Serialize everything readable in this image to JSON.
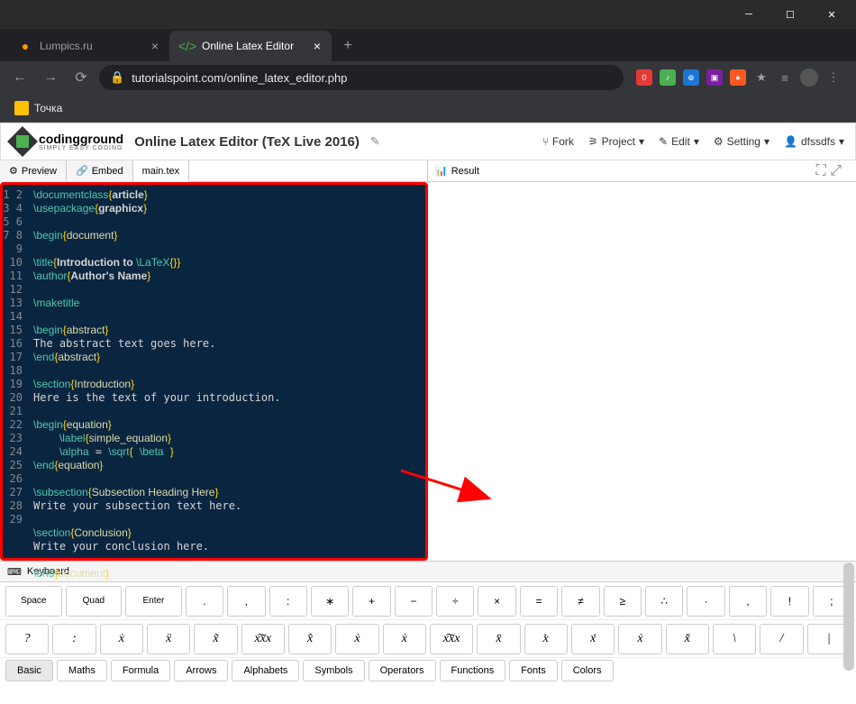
{
  "tabs": [
    {
      "label": "Lumpics.ru",
      "icon_color": "#ff9800"
    },
    {
      "label": "Online Latex Editor",
      "icon_color": "#4caf50"
    }
  ],
  "url": "tutorialspoint.com/online_latex_editor.php",
  "bookmark": "Точка",
  "logo": {
    "main": "codingground",
    "sub": "SIMPLY EASY CODING"
  },
  "page_title": "Online Latex Editor (TeX Live 2016)",
  "header_actions": {
    "fork": "Fork",
    "project": "Project",
    "edit": "Edit",
    "setting": "Setting",
    "user": "dfssdfs"
  },
  "panel_tabs": {
    "preview": "Preview",
    "embed": "Embed",
    "file": "main.tex",
    "result": "Result"
  },
  "code_lines": [
    {
      "n": 1,
      "html": "<span class='kw'>\\documentclass</span><span class='br'>{</span><span class='arg'>article</span><span class='br'>}</span>"
    },
    {
      "n": 2,
      "html": "<span class='kw'>\\usepackage</span><span class='br'>{</span><span class='arg'>graphicx</span><span class='br'>}</span>"
    },
    {
      "n": 3,
      "html": ""
    },
    {
      "n": 4,
      "html": "<span class='kw'>\\begin</span><span class='br'>{</span><span class='cur'>document</span><span class='br'>}</span>"
    },
    {
      "n": 5,
      "html": ""
    },
    {
      "n": 6,
      "html": "<span class='kw'>\\title</span><span class='br'>{</span><span class='arg'>Introduction to </span><span class='kw'>\\LaTeX</span><span class='br'>{}}</span>"
    },
    {
      "n": 7,
      "html": "<span class='kw'>\\author</span><span class='br'>{</span><span class='arg'>Author's Name</span><span class='br'>}</span>"
    },
    {
      "n": 8,
      "html": ""
    },
    {
      "n": 9,
      "html": "<span class='kw'>\\maketitle</span>"
    },
    {
      "n": 10,
      "html": ""
    },
    {
      "n": 11,
      "html": "<span class='kw'>\\begin</span><span class='br'>{</span><span class='cur'>abstract</span><span class='br'>}</span>"
    },
    {
      "n": 12,
      "html": "The abstract text goes here."
    },
    {
      "n": 13,
      "html": "<span class='kw'>\\end</span><span class='br'>{</span><span class='cur'>abstract</span><span class='br'>}</span>"
    },
    {
      "n": 14,
      "html": ""
    },
    {
      "n": 15,
      "html": "<span class='kw'>\\section</span><span class='br'>{</span><span class='cur'>Introduction</span><span class='br'>}</span>"
    },
    {
      "n": 16,
      "html": "Here is the text of your introduction."
    },
    {
      "n": 17,
      "html": ""
    },
    {
      "n": 18,
      "html": "<span class='kw'>\\begin</span><span class='br'>{</span><span class='cur'>equation</span><span class='br'>}</span>"
    },
    {
      "n": 19,
      "html": "    <span class='kw'>\\label</span><span class='br'>{</span><span class='cur'>simple_equation</span><span class='br'>}</span>"
    },
    {
      "n": 20,
      "html": "    <span class='kw'>\\alpha</span> = <span class='kw'>\\sqrt</span><span class='br'>{</span> <span class='kw'>\\beta</span> <span class='br'>}</span>"
    },
    {
      "n": 21,
      "html": "<span class='kw'>\\end</span><span class='br'>{</span><span class='cur'>equation</span><span class='br'>}</span>"
    },
    {
      "n": 22,
      "html": ""
    },
    {
      "n": 23,
      "html": "<span class='kw'>\\subsection</span><span class='br'>{</span><span class='cur'>Subsection Heading Here</span><span class='br'>}</span>"
    },
    {
      "n": 24,
      "html": "Write your subsection text here."
    },
    {
      "n": 25,
      "html": ""
    },
    {
      "n": 26,
      "html": "<span class='kw'>\\section</span><span class='br'>{</span><span class='cur'>Conclusion</span><span class='br'>}</span>"
    },
    {
      "n": 27,
      "html": "Write your conclusion here."
    },
    {
      "n": 28,
      "html": ""
    },
    {
      "n": 29,
      "html": "<span class='kw'>\\end</span><span class='br'>{</span><span class='cur'>document</span><span class='br'>}</span>"
    }
  ],
  "kb_label": "Keyboard",
  "kb_row1": [
    "Space",
    "Quad",
    "Enter",
    ".",
    ",",
    ":",
    "∗",
    "+",
    "−",
    "÷",
    "×",
    "=",
    "≠",
    "≥",
    "∴",
    "·",
    ",",
    "!",
    ";"
  ],
  "kb_row2": [
    "?",
    ":",
    "ẋ",
    "ẍ",
    "x̃",
    "x͠xx",
    "x̂",
    "ẋ",
    "ẋ",
    "x͠xx",
    "x̄",
    "x̀",
    "x́",
    "ẋ",
    "x̌",
    "\\",
    "/",
    "|"
  ],
  "kb_tabs": [
    "Basic",
    "Maths",
    "Formula",
    "Arrows",
    "Alphabets",
    "Symbols",
    "Operators",
    "Functions",
    "Fonts",
    "Colors"
  ]
}
